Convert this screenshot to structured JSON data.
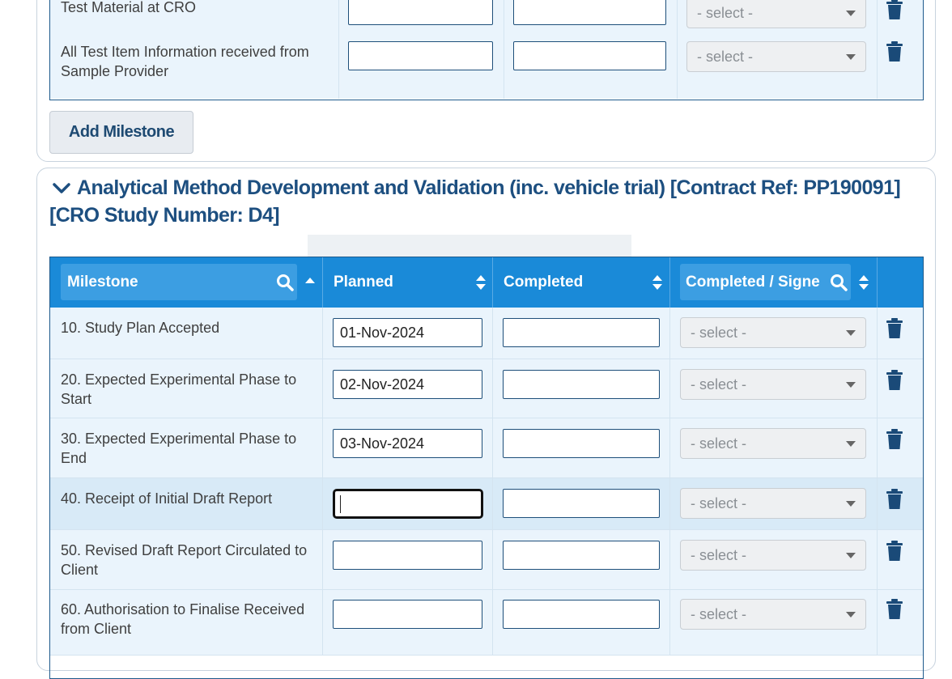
{
  "top_section": {
    "rows": [
      {
        "label": "Test Material at CRO",
        "planned": "",
        "completed": "",
        "signed": "- select -"
      },
      {
        "label": "All Test Item Information received from Sample Provider",
        "planned": "",
        "completed": "",
        "signed": "- select -"
      }
    ],
    "add_button": "Add Milestone"
  },
  "section": {
    "title": "Analytical Method Development and Validation (inc. vehicle trial) [Contract Ref: PP190091] [CRO Study Number: D4]",
    "columns": {
      "milestone": "Milestone",
      "planned": "Planned",
      "completed": "Completed",
      "signed": "Completed / Signe"
    },
    "rows": [
      {
        "label": "10. Study Plan Accepted",
        "planned": "01-Nov-2024",
        "completed": "",
        "signed": "- select -"
      },
      {
        "label": "20. Expected Experimental Phase to Start",
        "planned": "02-Nov-2024",
        "completed": "",
        "signed": "- select -"
      },
      {
        "label": "30. Expected Experimental Phase to End",
        "planned": "03-Nov-2024",
        "completed": "",
        "signed": "- select -"
      },
      {
        "label": "40. Receipt of Initial Draft Report",
        "planned": "",
        "completed": "",
        "signed": "- select -"
      },
      {
        "label": "50. Revised Draft Report Circulated to Client",
        "planned": "",
        "completed": "",
        "signed": "- select -"
      },
      {
        "label": "60. Authorisation to Finalise Received from Client",
        "planned": "",
        "completed": "",
        "signed": "- select -"
      }
    ]
  },
  "colors": {
    "header_bg": "#1a8ad8",
    "row_bg": "#eaf4fc",
    "title_text": "#1d4f80",
    "trash_icon": "#1a4a78"
  }
}
